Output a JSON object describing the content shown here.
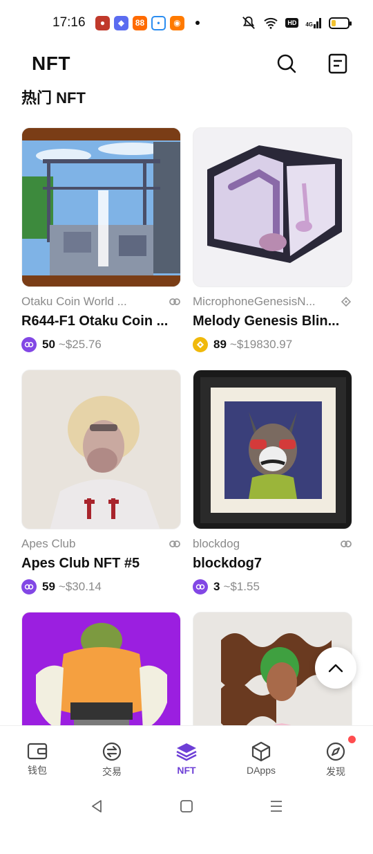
{
  "status_bar": {
    "time": "17:16",
    "battery_level": 0.25,
    "network": "4G",
    "hd_label": "HD"
  },
  "header": {
    "title": "NFT"
  },
  "section": {
    "title": "热门 NFT"
  },
  "cards": [
    {
      "collection": "Otaku Coin World ...",
      "name": "R644-F1 Otaku Coin ...",
      "price": "50",
      "usd": "~$25.76",
      "chain": "polygon",
      "chain_color": "#8247e5"
    },
    {
      "collection": "MicrophoneGenesisN...",
      "name": "Melody Genesis Blin...",
      "price": "89",
      "usd": "~$19830.97",
      "chain": "bnb",
      "chain_color": "#f0b90b"
    },
    {
      "collection": "Apes Club",
      "name": "Apes Club NFT #5",
      "price": "59",
      "usd": "~$30.14",
      "chain": "polygon",
      "chain_color": "#8247e5"
    },
    {
      "collection": "blockdog",
      "name": "blockdog7",
      "price": "3",
      "usd": "~$1.55",
      "chain": "polygon",
      "chain_color": "#8247e5"
    }
  ],
  "bottom_nav": [
    {
      "label": "钱包",
      "icon": "wallet-icon"
    },
    {
      "label": "交易",
      "icon": "swap-icon"
    },
    {
      "label": "NFT",
      "icon": "layers-icon",
      "active": true
    },
    {
      "label": "DApps",
      "icon": "cube-icon"
    },
    {
      "label": "发现",
      "icon": "compass-icon",
      "badge": true
    }
  ],
  "colors": {
    "accent": "#6d3fd6",
    "muted": "#8a8a8a"
  }
}
